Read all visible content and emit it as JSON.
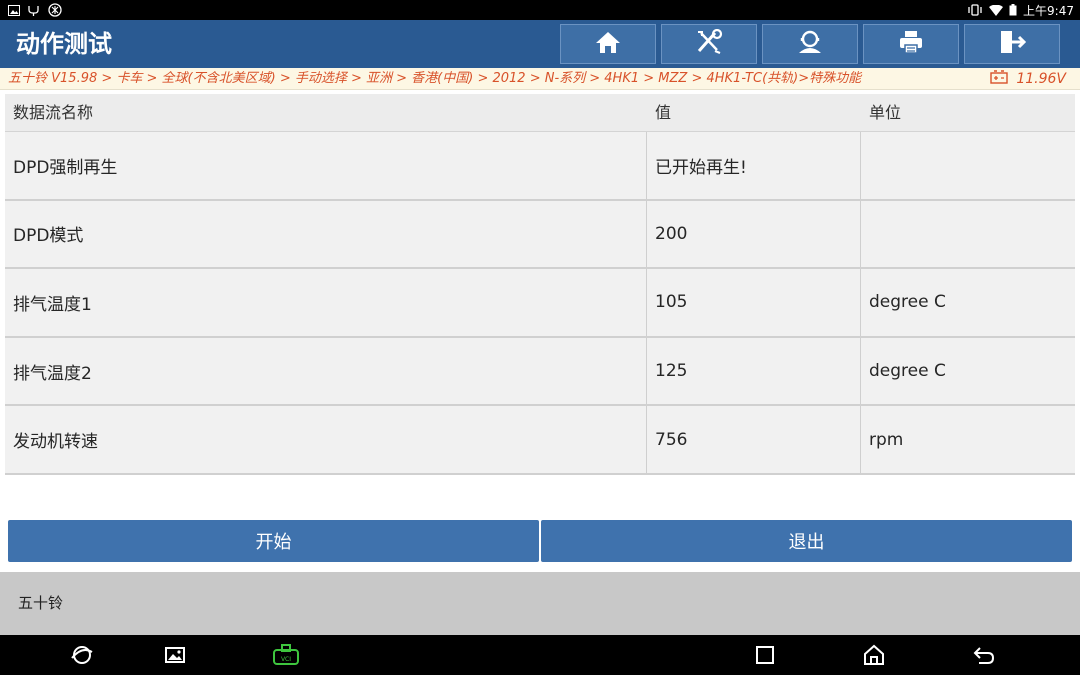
{
  "status_bar": {
    "time": "上午9:47",
    "left_icons": [
      "image-icon",
      "usb-icon",
      "settings-icon"
    ],
    "right_icons": [
      "vibrate-icon",
      "wifi-icon",
      "battery-icon"
    ]
  },
  "header": {
    "title": "动作测试",
    "buttons": [
      "home-icon",
      "diagnose-icon",
      "user-icon",
      "print-icon",
      "exit-icon"
    ]
  },
  "breadcrumb": {
    "path": "五十铃 V15.98 > 卡车 > 全球(不含北美区域) > 手动选择 > 亚洲 > 香港(中国) > 2012 > N-系列 > 4HK1 > MZZ > 4HK1-TC(共轨)>特殊功能",
    "voltage": "11.96V"
  },
  "table": {
    "columns": [
      "数据流名称",
      "值",
      "单位"
    ],
    "rows": [
      {
        "name": "DPD强制再生",
        "value": "已开始再生!",
        "unit": ""
      },
      {
        "name": "DPD模式",
        "value": "200",
        "unit": ""
      },
      {
        "name": "排气温度1",
        "value": "105",
        "unit": "degree C"
      },
      {
        "name": "排气温度2",
        "value": "125",
        "unit": "degree C"
      },
      {
        "name": "发动机转速",
        "value": "756",
        "unit": "rpm"
      }
    ]
  },
  "actions": {
    "start_label": "开始",
    "exit_label": "退出"
  },
  "footer": {
    "brand": "五十铃"
  },
  "colors": {
    "header_bg": "#2a5a92",
    "button_bg": "#3f72ad",
    "breadcrumb_text": "#d8522a",
    "breadcrumb_bg": "#fdf7e4"
  }
}
